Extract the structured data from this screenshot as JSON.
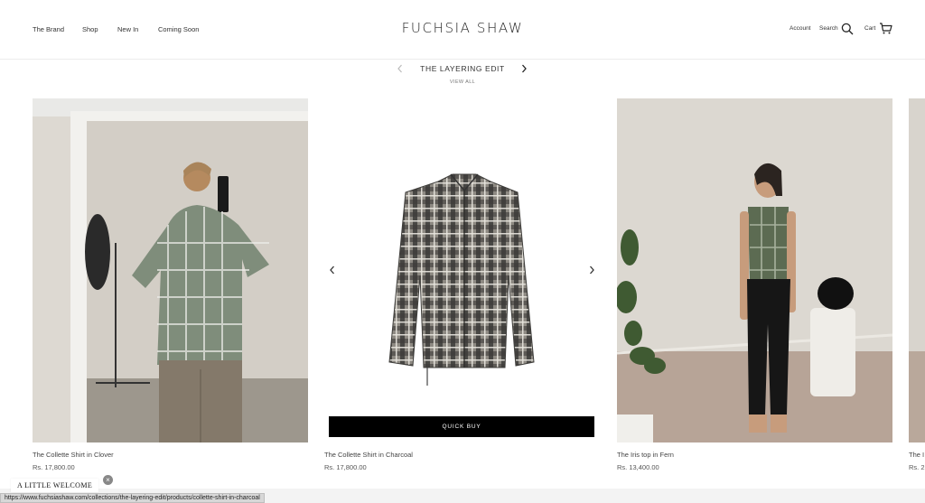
{
  "header": {
    "nav_left": [
      "The Brand",
      "Shop",
      "New In",
      "Coming Soon"
    ],
    "brand": "FUCHSIA SHAW",
    "account": "Account",
    "search": "Search",
    "cart": "Cart"
  },
  "collection": {
    "title": "THE LAYERING EDIT",
    "view_all": "VIEW ALL"
  },
  "products": [
    {
      "name": "The Collette Shirt in Clover",
      "price": "Rs. 17,800.00"
    },
    {
      "name": "The Collette Shirt in Charcoal",
      "price": "Rs. 17,800.00",
      "quick_buy": "QUICK BUY"
    },
    {
      "name": "The Iris top in Fern",
      "price": "Rs. 13,400.00"
    },
    {
      "name": "The I",
      "price": "Rs. 2"
    }
  ],
  "popup": {
    "label": "A LITTLE WELCOME",
    "close": "×"
  },
  "status_bar": {
    "url": "https://www.fuchsiashaw.com/collections/the-layering-edit/products/collette-shirt-in-charcoal"
  },
  "colors": {
    "quick_buy_bg": "#000000",
    "text": "#222222"
  }
}
